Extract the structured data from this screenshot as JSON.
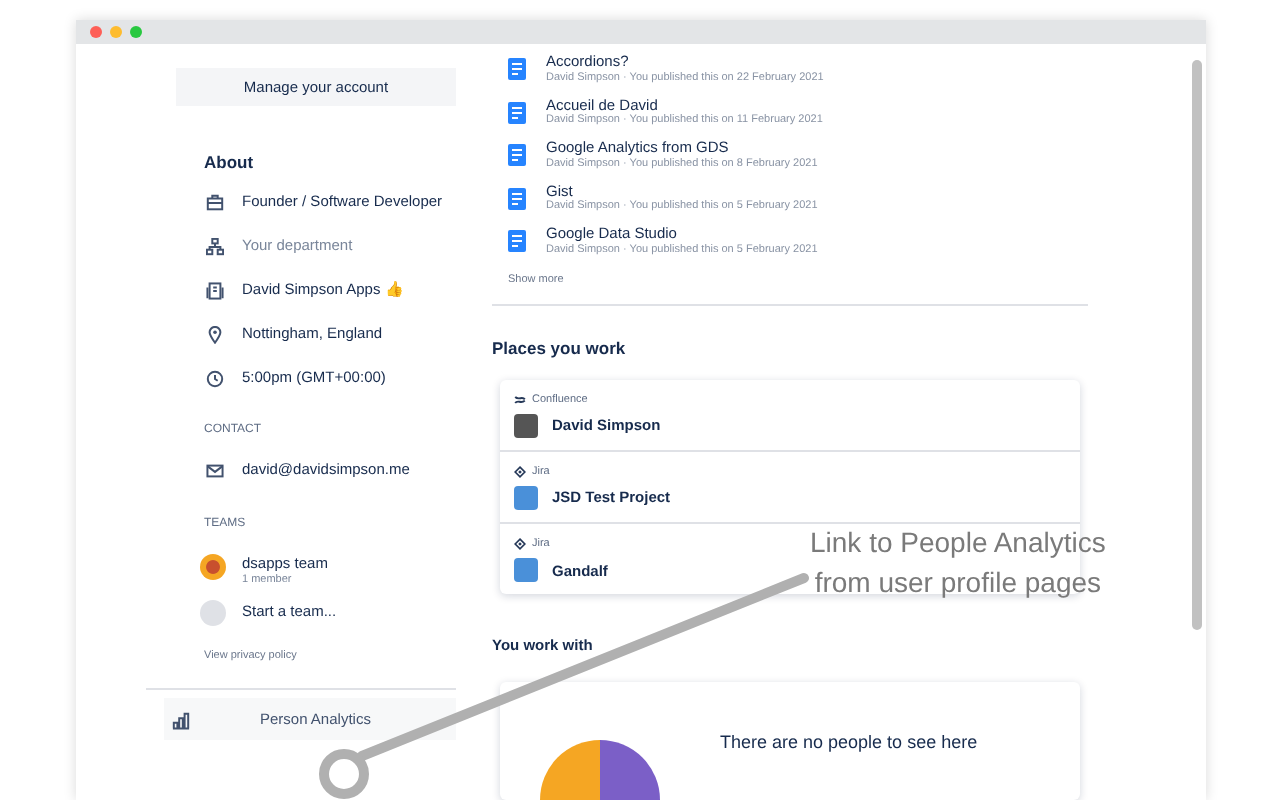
{
  "window": {
    "controls": [
      {
        "color": "#fe5f57"
      },
      {
        "color": "#febc2e"
      },
      {
        "color": "#28c840"
      }
    ]
  },
  "sidebar": {
    "manage_button": "Manage your account",
    "about_heading": "About",
    "about_items": [
      {
        "kind": "job",
        "text": "Founder / Software Developer",
        "muted": false
      },
      {
        "kind": "department",
        "text": "Your department",
        "muted": true
      },
      {
        "kind": "company",
        "text": "David Simpson Apps 👍",
        "muted": false
      },
      {
        "kind": "location",
        "text": "Nottingham, England",
        "muted": false
      },
      {
        "kind": "time",
        "text": "5:00pm (GMT+00:00)",
        "muted": false
      }
    ],
    "contact_heading": "CONTACT",
    "email": "david@davidsimpson.me",
    "teams_heading": "TEAMS",
    "teams": [
      {
        "name": "dsapps team",
        "members": "1 member"
      }
    ],
    "start_team": "Start a team...",
    "privacy_link": "View privacy policy",
    "analytics_button": "Person Analytics"
  },
  "documents": [
    {
      "title": "Accordions?",
      "meta": "David Simpson · You published this on 22 February 2021"
    },
    {
      "title": "Accueil de David",
      "meta": "David Simpson · You published this on 11 February 2021"
    },
    {
      "title": "Google Analytics from GDS",
      "meta": "David Simpson · You published this on 8 February 2021"
    },
    {
      "title": "Gist",
      "meta": "David Simpson · You published this on 5 February 2021"
    },
    {
      "title": "Google Data Studio",
      "meta": "David Simpson · You published this on 5 February 2021"
    }
  ],
  "show_more": "Show more",
  "places_heading": "Places you work",
  "places": [
    {
      "product": "Confluence",
      "kind": "confluence",
      "name": "David Simpson"
    },
    {
      "product": "Jira",
      "kind": "jira",
      "name": "JSD Test Project"
    },
    {
      "product": "Jira",
      "kind": "jira",
      "name": "Gandalf"
    }
  ],
  "work_with_heading": "You work with",
  "empty_people": "There are no people to see here",
  "annotation": {
    "lines": [
      "Link to People Analytics",
      "from user profile pages"
    ]
  }
}
